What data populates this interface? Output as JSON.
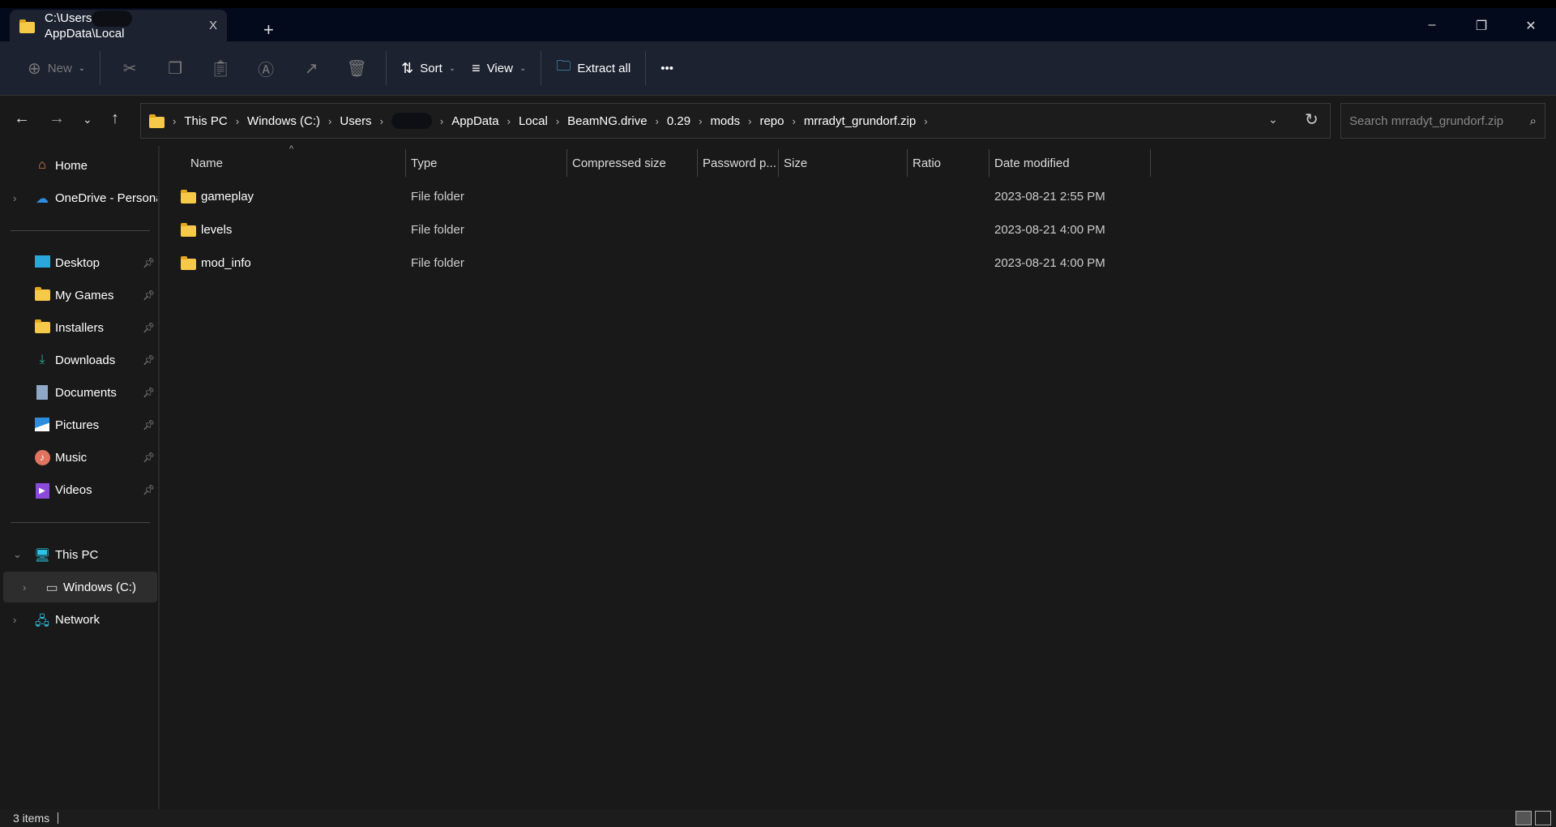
{
  "tab": {
    "title_start": "C:\\Users",
    "title_end": "AppData\\Local",
    "close": "X",
    "new_tab": "+"
  },
  "window": {
    "minimize": "–",
    "maximize": "❐",
    "close": "✕"
  },
  "toolbar": {
    "new": "New",
    "sort": "Sort",
    "view": "View",
    "extract_all": "Extract all",
    "more": "•••"
  },
  "address": {
    "crumbs": [
      "This PC",
      "Windows (C:)",
      "Users",
      "",
      "AppData",
      "Local",
      "BeamNG.drive",
      "0.29",
      "mods",
      "repo",
      "mrradyt_grundorf.zip"
    ]
  },
  "search": {
    "placeholder": "Search mrradyt_grundorf.zip"
  },
  "sidebar": {
    "home": "Home",
    "onedrive": "OneDrive - Personal",
    "pinned": [
      "Desktop",
      "My Games",
      "Installers",
      "Downloads",
      "Documents",
      "Pictures",
      "Music",
      "Videos"
    ],
    "this_pc": "This PC",
    "windows_c": "Windows (C:)",
    "network": "Network"
  },
  "columns": [
    "Name",
    "Type",
    "Compressed size",
    "Password p...",
    "Size",
    "Ratio",
    "Date modified"
  ],
  "rows": [
    {
      "name": "gameplay",
      "type": "File folder",
      "date": "2023-08-21 2:55 PM"
    },
    {
      "name": "levels",
      "type": "File folder",
      "date": "2023-08-21 4:00 PM"
    },
    {
      "name": "mod_info",
      "type": "File folder",
      "date": "2023-08-21 4:00 PM"
    }
  ],
  "status": {
    "items": "3 items"
  }
}
